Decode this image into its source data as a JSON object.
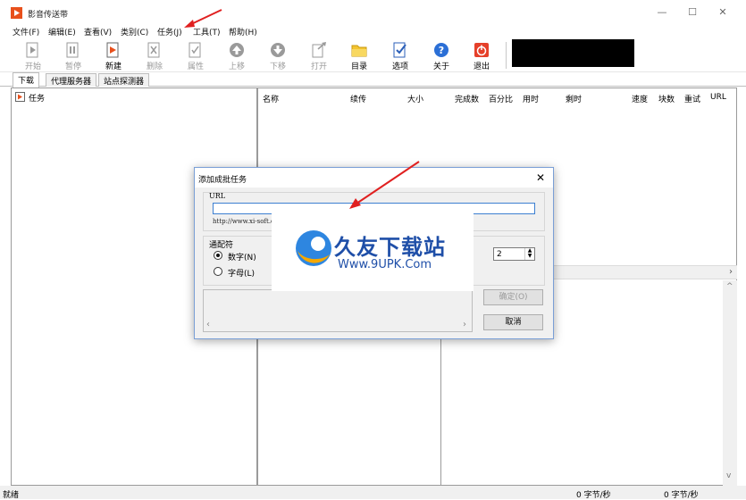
{
  "window": {
    "title": "影音传送带",
    "minimize": "—",
    "maximize": "☐",
    "close": "✕"
  },
  "menu": [
    "文件(F)",
    "编辑(E)",
    "查看(V)",
    "类别(C)",
    "任务(J)",
    "工具(T)",
    "帮助(H)"
  ],
  "toolbar": {
    "start": "开始",
    "pause": "暂停",
    "new": "新建",
    "delete": "删除",
    "properties": "属性",
    "move_up": "上移",
    "move_down": "下移",
    "open": "打开",
    "directory": "目录",
    "options": "选项",
    "about": "关于",
    "exit": "退出"
  },
  "tabs": [
    "下载",
    "代理服务器",
    "站点探测器"
  ],
  "tree": {
    "root": "任务"
  },
  "columns": [
    "名称",
    "续传",
    "大小",
    "完成数",
    "百分比",
    "用时",
    "剩时",
    "速度",
    "块数",
    "重试",
    "URL"
  ],
  "status": {
    "left": "就绪",
    "speed1": "0 字节/秒",
    "speed2": "0 字节/秒"
  },
  "dialog": {
    "title": "添加成批任务",
    "close": "✕",
    "url_label": "URL",
    "url_value": "",
    "url_example": "http://www.xi-soft.com/dir(*)/file(*).zip",
    "wildcard_label": "通配符",
    "opt_numeric": "数字(N)",
    "opt_letter": "字母(L)",
    "spin_value": "2",
    "ok": "确定(O)",
    "cancel": "取消"
  },
  "watermark": {
    "brand": "久友下载站",
    "url": "Www.9UPK.Com"
  },
  "colors": {
    "accent_red": "#e02020",
    "dialog_border": "#7a9fd6",
    "watermark_blue": "#1f4fa8"
  }
}
